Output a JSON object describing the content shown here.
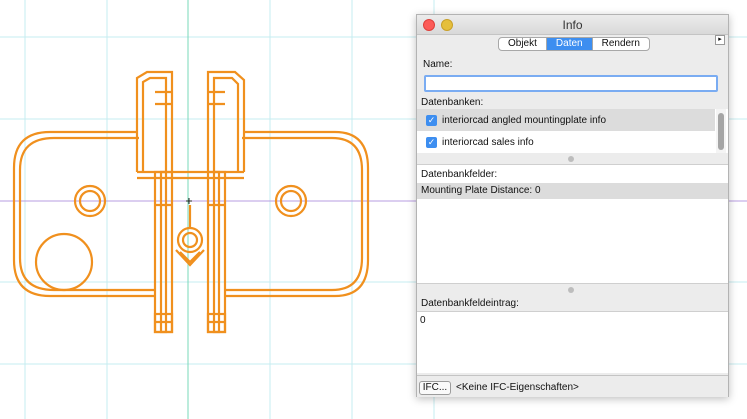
{
  "palette": {
    "title": "Info",
    "tabs": [
      {
        "label": "Objekt",
        "active": false
      },
      {
        "label": "Daten",
        "active": true
      },
      {
        "label": "Rendern",
        "active": false
      }
    ],
    "menu_glyph": "▸",
    "name_label": "Name:",
    "name_value": "",
    "databases_label": "Datenbanken:",
    "databases": [
      {
        "label": "interiorcad angled mountingplate info",
        "checked": true,
        "selected": true
      },
      {
        "label": "interiorcad sales info",
        "checked": true,
        "selected": false
      }
    ],
    "db_fields_label": "Datenbankfelder:",
    "db_fields": [
      {
        "label": "Mounting Plate Distance: 0",
        "selected": true
      }
    ],
    "entry_label": "Datenbankfeldeintrag:",
    "entry_value": "0",
    "ifc_button": "IFC...",
    "ifc_status": "<Keine IFC-Eigenschaften>"
  },
  "colors": {
    "drawing_stroke": "#f0901e",
    "grid": "#c6ecf0",
    "vertical_axis": "#7ad8b8",
    "horizontal_axis": "#b79ce0",
    "accent": "#3d8ef0"
  }
}
